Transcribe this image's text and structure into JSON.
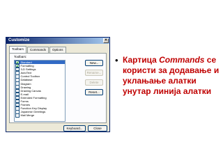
{
  "dialog": {
    "title": "Customize",
    "close_glyph": "×",
    "tabs": [
      "Toolbars",
      "Commands",
      "Options"
    ],
    "toolbars_label": "Toolbars:",
    "toolbars": [
      {
        "label": "Standard",
        "checked": true,
        "selected": true
      },
      {
        "label": "Formatting",
        "checked": true,
        "selected": false
      },
      {
        "label": "3-D Settings",
        "checked": false,
        "selected": false
      },
      {
        "label": "AutoText",
        "checked": false,
        "selected": false
      },
      {
        "label": "Control Toolbox",
        "checked": false,
        "selected": false
      },
      {
        "label": "Database",
        "checked": false,
        "selected": false
      },
      {
        "label": "Diagram",
        "checked": false,
        "selected": false
      },
      {
        "label": "Drawing",
        "checked": false,
        "selected": false
      },
      {
        "label": "Drawing Canvas",
        "checked": false,
        "selected": false
      },
      {
        "label": "E-mail",
        "checked": false,
        "selected": false
      },
      {
        "label": "Extended Formatting",
        "checked": false,
        "selected": false
      },
      {
        "label": "Forms",
        "checked": false,
        "selected": false
      },
      {
        "label": "Frames",
        "checked": false,
        "selected": false
      },
      {
        "label": "Function Key Display",
        "checked": false,
        "selected": false
      },
      {
        "label": "Japanese Greetings",
        "checked": false,
        "selected": false
      },
      {
        "label": "Mail Merge",
        "checked": false,
        "selected": false
      }
    ],
    "buttons": {
      "new": "New...",
      "rename": "Rename...",
      "delete": "Delete",
      "reset": "Reset...",
      "keyboard": "Keyboard...",
      "close": "Close"
    }
  },
  "bullet": {
    "mark": "•",
    "text_prefix": "Картица ",
    "text_emphasis": "Commands",
    "text_suffix": " се користи за додавање и уклањање алатки унутар линија алатки"
  },
  "colors": {
    "bullet_text": "#c00000",
    "title_bar": "#0a246a",
    "selection": "#316ac5"
  }
}
